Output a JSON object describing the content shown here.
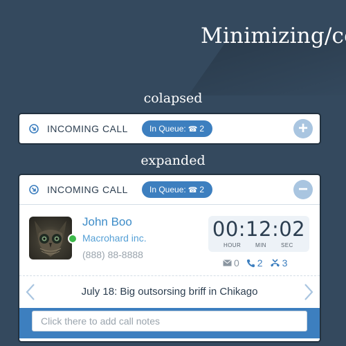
{
  "heading": "Minimizing/co",
  "sections": {
    "collapsed_label": "colapsed",
    "expanded_label": "expanded"
  },
  "collapsed_card": {
    "title": "INCOMING CALL",
    "queue_label": "In Queue:",
    "queue_count": "2",
    "toggle_symbol": "+"
  },
  "expanded_card": {
    "title": "INCOMING CALL",
    "queue_label": "In Queue:",
    "queue_count": "2",
    "toggle_symbol": "−",
    "caller": {
      "name": "John Boo",
      "company": "Macrohard inc.",
      "phone": "(888) 88-8888",
      "status": "online"
    },
    "timer": {
      "display": "00:12:02",
      "hour_label": "HOUR",
      "min_label": "MIN",
      "sec_label": "SEC"
    },
    "counts": {
      "messages": "0",
      "calls": "2",
      "missed_calls": "3"
    },
    "note": "July 18: Big outsorsing briff in Chikago",
    "notes_placeholder": "Click there to add call notes"
  },
  "colors": {
    "background": "#34495e",
    "accent": "#3d7fbf",
    "link": "#3d8cc8",
    "online": "#3cb94a",
    "toggle": "#a9c5e0"
  },
  "icons": {
    "header": "incoming-call-icon",
    "queue": "phone-icon",
    "messages": "envelope-icon",
    "calls": "phone-icon",
    "missed": "missed-call-icon",
    "prev": "chevron-left-icon",
    "next": "chevron-right-icon"
  }
}
